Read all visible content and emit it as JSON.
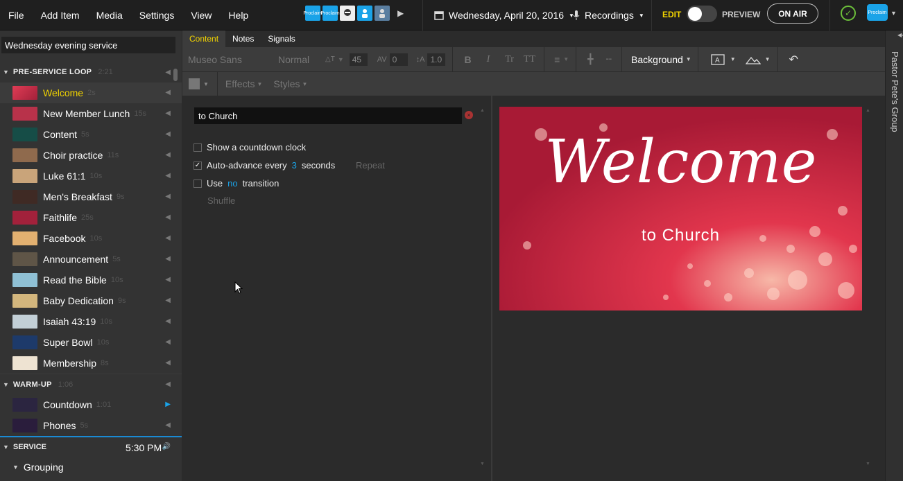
{
  "menu": [
    "File",
    "Add Item",
    "Media",
    "Settings",
    "View",
    "Help"
  ],
  "quick_icons": [
    {
      "name": "proclaim-slide-icon",
      "label": "Proclaim"
    },
    {
      "name": "proclaim-text-icon",
      "label": "Proclaim"
    },
    {
      "name": "photo-icon",
      "label": ""
    },
    {
      "name": "person-icon",
      "label": ""
    },
    {
      "name": "person-grey-icon",
      "label": ""
    }
  ],
  "date": "Wednesday, April 20, 2016",
  "recordings": "Recordings",
  "mode": {
    "edit": "EDIT",
    "preview": "PREVIEW",
    "on_air": "ON AIR"
  },
  "brand": "Proclaim",
  "service_name": "Wednesday evening service",
  "sections": [
    {
      "title": "PRE-SERVICE LOOP",
      "duration": "2:21",
      "items": [
        {
          "title": "Welcome",
          "duration": "2s",
          "thumb": "#c42c43"
        },
        {
          "title": "New Member Lunch",
          "duration": "15s",
          "thumb": "#b8324a"
        },
        {
          "title": "Content",
          "duration": "5s",
          "thumb": "#164d47"
        },
        {
          "title": "Choir practice",
          "duration": "11s",
          "thumb": "#8f6a4d"
        },
        {
          "title": "Luke 61:1",
          "duration": "10s",
          "thumb": "#c9a47a"
        },
        {
          "title": "Men's Breakfast",
          "duration": "9s",
          "thumb": "#3f2a24"
        },
        {
          "title": "Faithlife",
          "duration": "25s",
          "thumb": "#a2213b"
        },
        {
          "title": "Facebook",
          "duration": "10s",
          "thumb": "#e2b070"
        },
        {
          "title": "Announcement",
          "duration": "5s",
          "thumb": "#5f5547"
        },
        {
          "title": "Read the Bible",
          "duration": "10s",
          "thumb": "#8fc0d4"
        },
        {
          "title": "Baby Dedication",
          "duration": "9s",
          "thumb": "#d3b67d"
        },
        {
          "title": "Isaiah 43:19",
          "duration": "10s",
          "thumb": "#c2cfd6"
        },
        {
          "title": "Super Bowl",
          "duration": "10s",
          "thumb": "#1d3a6a"
        },
        {
          "title": "Membership",
          "duration": "8s",
          "thumb": "#eee3d2"
        }
      ]
    },
    {
      "title": "WARM-UP",
      "duration": "1:06",
      "items": [
        {
          "title": "Countdown",
          "duration": "1:01",
          "thumb": "#2b2540"
        },
        {
          "title": "Phones",
          "duration": "5s",
          "thumb": "#2a1d3c"
        }
      ]
    }
  ],
  "service_section": {
    "title": "SERVICE",
    "time": "5:30 PM"
  },
  "grouping": "Grouping",
  "tabs": [
    "Content",
    "Notes",
    "Signals"
  ],
  "toolbar": {
    "font": "Museo Sans",
    "weight": "Normal",
    "size": "45",
    "spacing": "0",
    "line_height": "1.0",
    "bold": "B",
    "italic": "I",
    "tr1": "Tr",
    "tr2": "TT",
    "background": "Background",
    "effects": "Effects",
    "styles": "Styles"
  },
  "content": {
    "text_value": "to Church",
    "countdown_label": "Show a countdown clock",
    "auto_advance": {
      "prefix": "Auto-advance every",
      "seconds": "3",
      "suffix": "seconds"
    },
    "repeat": "Repeat",
    "transition": {
      "prefix": "Use",
      "value": "no",
      "suffix": "transition"
    },
    "shuffle": "Shuffle"
  },
  "preview": {
    "title": "Welcome",
    "subtitle": "to Church"
  },
  "rail_group": "Pastor Pete's Group"
}
